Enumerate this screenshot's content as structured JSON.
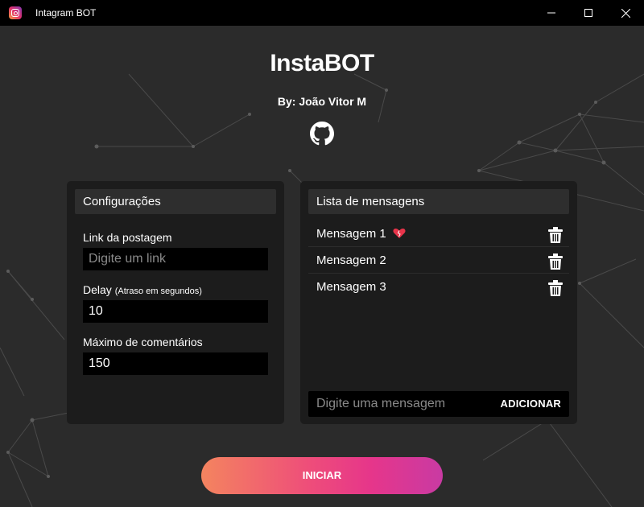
{
  "window": {
    "title": "Intagram BOT"
  },
  "header": {
    "title": "InstaBOT",
    "author": "By: João Vitor M",
    "github_icon": "github-icon"
  },
  "config": {
    "title": "Configurações",
    "link": {
      "label": "Link da postagem",
      "placeholder": "Digite um link",
      "value": ""
    },
    "delay": {
      "label": "Delay",
      "hint": "(Atraso em segundos)",
      "value": "10"
    },
    "max_comments": {
      "label": "Máximo de comentários",
      "value": "150"
    }
  },
  "messages": {
    "title": "Lista de mensagens",
    "items": [
      {
        "text": "Mensagem 1",
        "emoji": "heart-icon"
      },
      {
        "text": "Mensagem 2"
      },
      {
        "text": "Mensagem 3"
      }
    ],
    "input_placeholder": "Digite uma mensagem",
    "add_label": "ADICIONAR"
  },
  "actions": {
    "start_label": "INICIAR"
  },
  "colors": {
    "background": "#2b2b2b",
    "panel": "#1c1c1c",
    "panel_header": "#2e2e2e",
    "input": "#000000",
    "gradient_start": "#f4845f",
    "gradient_mid": "#e6368a",
    "gradient_end": "#c93aa3"
  }
}
